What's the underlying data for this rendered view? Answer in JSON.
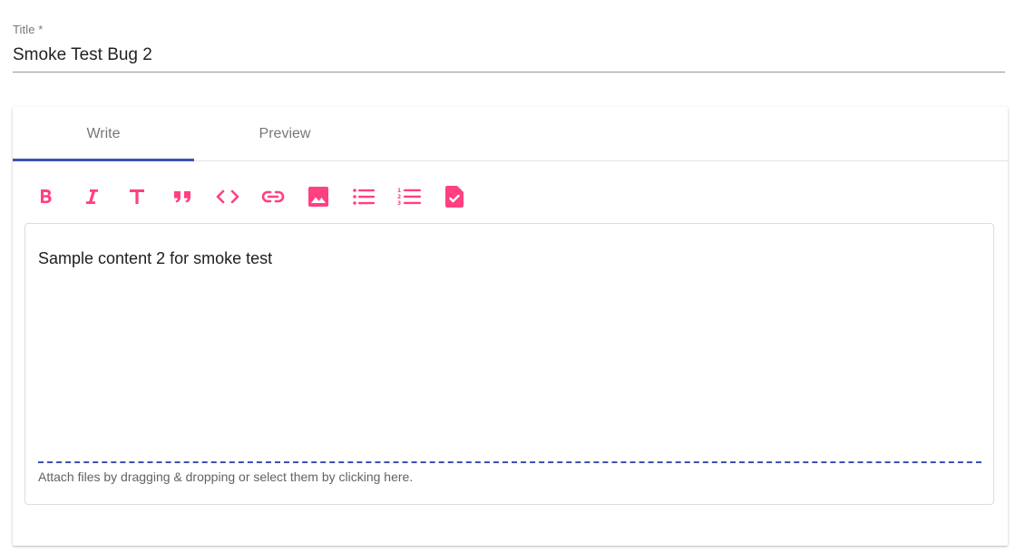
{
  "title_field": {
    "label": "Title *",
    "value": "Smoke Test Bug 2"
  },
  "editor": {
    "tabs": [
      {
        "label": "Write",
        "active": true
      },
      {
        "label": "Preview",
        "active": false
      }
    ],
    "toolbar": [
      {
        "icon": "bold-icon"
      },
      {
        "icon": "italic-icon"
      },
      {
        "icon": "header-icon"
      },
      {
        "icon": "quote-icon"
      },
      {
        "icon": "code-icon"
      },
      {
        "icon": "link-icon"
      },
      {
        "icon": "image-icon"
      },
      {
        "icon": "unordered-list-icon"
      },
      {
        "icon": "ordered-list-icon"
      },
      {
        "icon": "checked-list-icon"
      }
    ],
    "content": "Sample content 2 for smoke test",
    "attach_text": "Attach files by dragging & dropping or select them by clicking here."
  },
  "colors": {
    "accent": "#3f51b5",
    "toolbar_icon": "#ff4081"
  }
}
